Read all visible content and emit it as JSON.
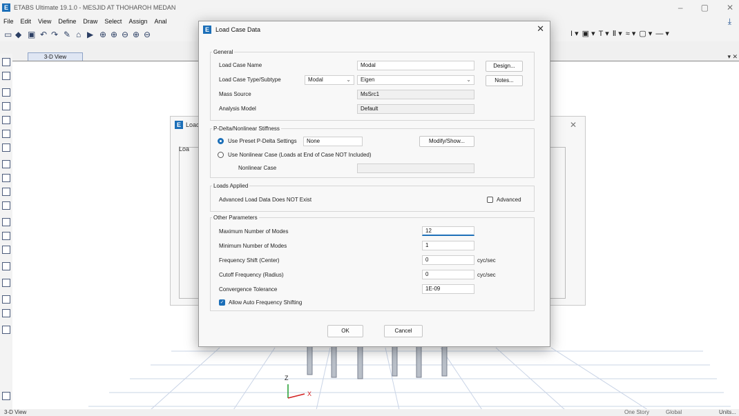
{
  "window": {
    "app_title": "ETABS Ultimate 19.1.0 - MESJID AT THOHAROH MEDAN",
    "app_icon_letter": "E"
  },
  "menu": [
    "File",
    "Edit",
    "View",
    "Define",
    "Draw",
    "Select",
    "Assign",
    "Anal"
  ],
  "view_tab": "3-D View",
  "status": {
    "left": "3-D View",
    "story": "One Story",
    "coord": "Global",
    "units": "Units..."
  },
  "background_dialog": {
    "title": "Load",
    "sub": "Loa"
  },
  "dialog": {
    "title": "Load Case Data",
    "general": {
      "group_title": "General",
      "name_label": "Load Case Name",
      "name_value": "Modal",
      "type_label": "Load Case Type/Subtype",
      "type_value": "Modal",
      "subtype_value": "Eigen",
      "mass_label": "Mass Source",
      "mass_value": "MsSrc1",
      "model_label": "Analysis Model",
      "model_value": "Default",
      "design_button": "Design...",
      "notes_button": "Notes..."
    },
    "pdelta": {
      "group_title": "P-Delta/Nonlinear Stiffness",
      "preset_label": "Use Preset P-Delta Settings",
      "preset_value": "None",
      "modify_button": "Modify/Show...",
      "nonlinear_label": "Use Nonlinear Case  (Loads at End of Case NOT Included)",
      "nonlinear_case_label": "Nonlinear Case",
      "nonlinear_case_value": ""
    },
    "loads": {
      "group_title": "Loads Applied",
      "text": "Advanced Load Data Does NOT Exist",
      "advanced_label": "Advanced"
    },
    "other": {
      "group_title": "Other Parameters",
      "max_modes_label": "Maximum Number of Modes",
      "max_modes_value": "12",
      "min_modes_label": "Minimum Number of Modes",
      "min_modes_value": "1",
      "shift_label": "Frequency Shift  (Center)",
      "shift_value": "0",
      "shift_unit": "cyc/sec",
      "cutoff_label": "Cutoff Frequency  (Radius)",
      "cutoff_value": "0",
      "cutoff_unit": "cyc/sec",
      "tol_label": "Convergence Tolerance",
      "tol_value": "1E-09",
      "auto_shift_label": "Allow Auto Frequency Shifting"
    },
    "ok_button": "OK",
    "cancel_button": "Cancel"
  },
  "axis": {
    "z": "Z",
    "x": "X"
  },
  "colors": {
    "accent": "#1c6fb8",
    "axis_x": "#d32020",
    "axis_z": "#1c9c2c"
  }
}
